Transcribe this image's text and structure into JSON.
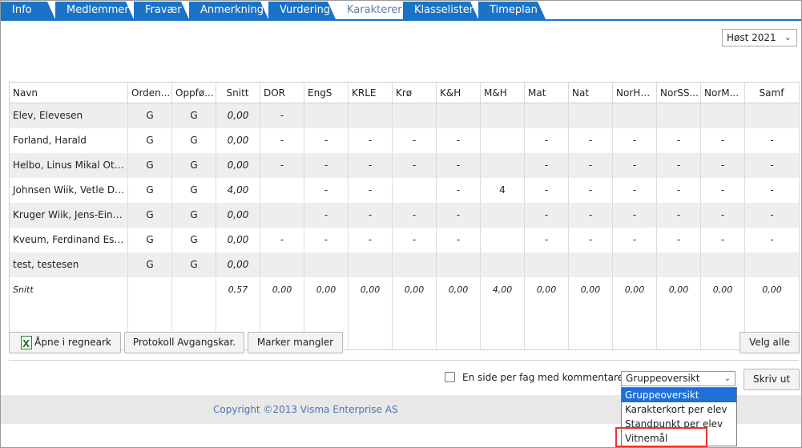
{
  "tabs": [
    {
      "label": "Info"
    },
    {
      "label": "Medlemmer"
    },
    {
      "label": "Fravær"
    },
    {
      "label": "Anmerkning"
    },
    {
      "label": "Vurdering"
    },
    {
      "label": "Karakterer"
    },
    {
      "label": "Klasselister"
    },
    {
      "label": "Timeplan"
    }
  ],
  "active_tab": "Karakterer",
  "term_select": {
    "value": "Høst 2021"
  },
  "grid": {
    "columns": [
      "Navn",
      "Orden...",
      "Oppfø...",
      "Snitt",
      "DOR",
      "EngS",
      "KRLE",
      "Krø",
      "K&H",
      "M&H",
      "Mat",
      "Nat",
      "NorHS...",
      "NorSS...",
      "NorM...",
      "Samf"
    ],
    "rows": [
      [
        "Elev, Elevesen",
        "G",
        "G",
        "0,00",
        "-",
        "",
        "",
        "",
        "",
        "",
        "",
        "",
        "",
        "",
        "",
        ""
      ],
      [
        "Forland, Harald",
        "G",
        "G",
        "0,00",
        "-",
        "-",
        "-",
        "-",
        "-",
        "",
        "-",
        "-",
        "-",
        "-",
        "-",
        "-"
      ],
      [
        "Helbo, Linus Mikal Otn...",
        "G",
        "G",
        "0,00",
        "-",
        "-",
        "-",
        "-",
        "-",
        "",
        "-",
        "-",
        "-",
        "-",
        "-",
        "-"
      ],
      [
        "Johnsen Wiik, Vetle Dahl",
        "G",
        "G",
        "4,00",
        "",
        "-",
        "-",
        "",
        "-",
        "4",
        "-",
        "-",
        "-",
        "-",
        "-",
        "-"
      ],
      [
        "Kruger Wiik, Jens-Einar ...",
        "G",
        "G",
        "0,00",
        "",
        "-",
        "-",
        "-",
        "-",
        "",
        "-",
        "-",
        "-",
        "-",
        "-",
        "-"
      ],
      [
        "Kveum, Ferdinand Eski...",
        "G",
        "G",
        "0,00",
        "-",
        "-",
        "-",
        "-",
        "-",
        "",
        "-",
        "-",
        "-",
        "-",
        "-",
        "-"
      ],
      [
        "test, testesen",
        "G",
        "G",
        "0,00",
        "",
        "",
        "",
        "",
        "",
        "",
        "",
        "",
        "",
        "",
        "",
        ""
      ]
    ],
    "snitt_row": [
      "Snitt",
      "",
      "",
      "0,57",
      "0,00",
      "0,00",
      "0,00",
      "0,00",
      "0,00",
      "4,00",
      "0,00",
      "0,00",
      "0,00",
      "0,00",
      "0,00",
      "0,00"
    ]
  },
  "buttons": {
    "open_spreadsheet": "Åpne i regneark",
    "protocol": "Protokoll Avgangskar.",
    "mark_missing": "Marker mangler",
    "select_all": "Velg alle",
    "print": "Skriv ut"
  },
  "report_options": {
    "checkbox_label": "En side per fag med kommentarer",
    "selected": "Gruppeoversikt",
    "options": [
      "Gruppeoversikt",
      "Karakterkort per elev",
      "Standpunkt per elev",
      "Vitnemål"
    ]
  },
  "footer": {
    "copyright": "Copyright ©2013 Visma Enterprise AS"
  },
  "colors": {
    "tab_blue": "#1a73c7",
    "highlight": "#e8342c",
    "link": "#4a76b3"
  }
}
